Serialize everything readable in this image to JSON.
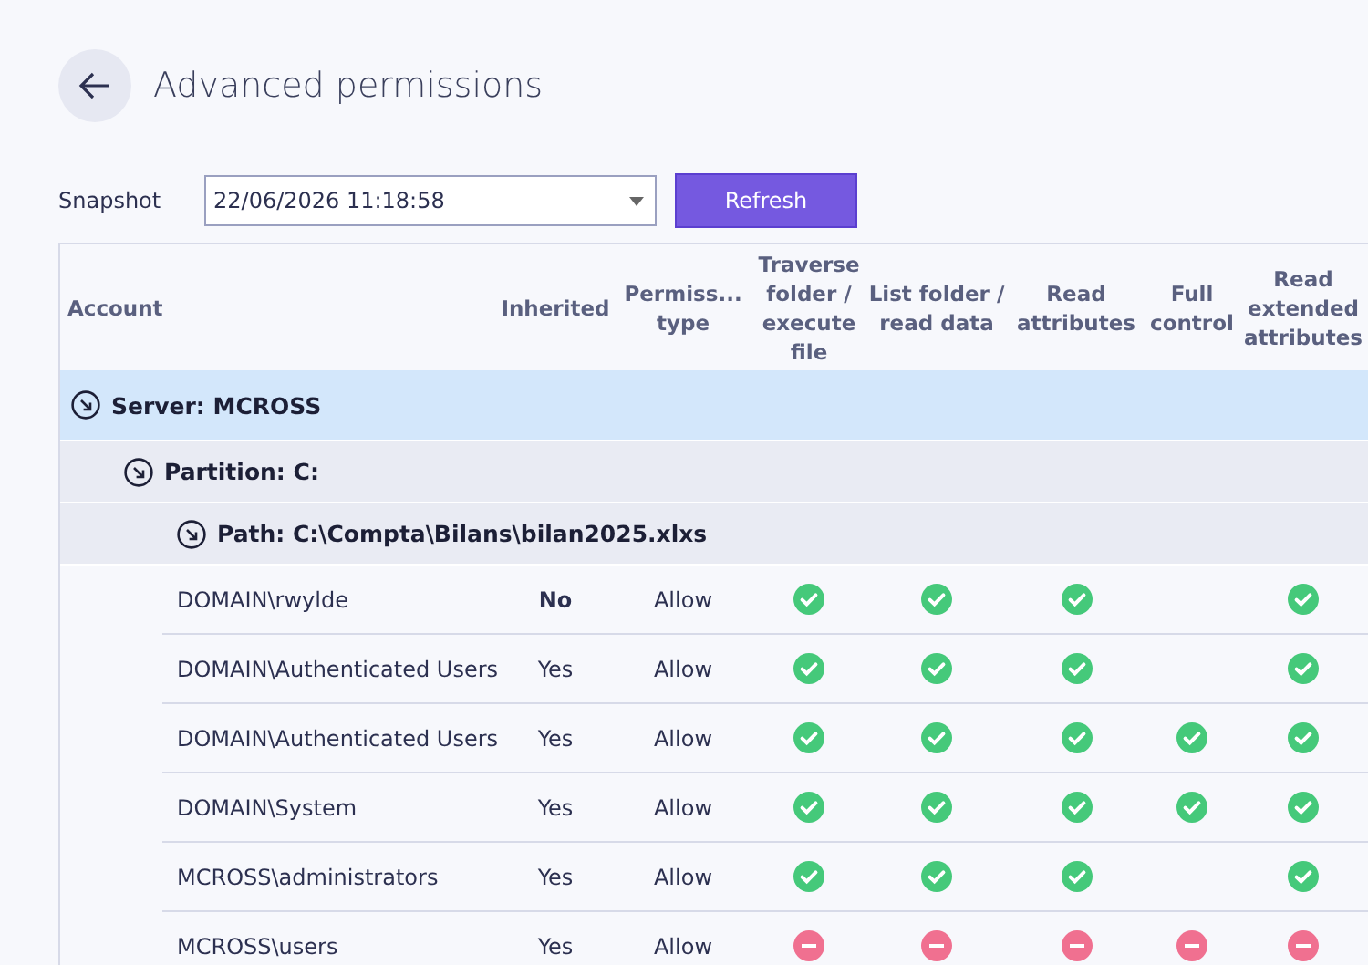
{
  "title": "Advanced permissions",
  "snapshot": {
    "label": "Snapshot",
    "value": "22/06/2026 11:18:58"
  },
  "refresh_button": "Refresh",
  "table": {
    "columns": [
      "Account",
      "Inherited",
      "Permiss... type",
      "Traverse folder / execute file",
      "List folder / read data",
      "Read attributes",
      "Full control",
      "Read extended attributes"
    ],
    "tree": [
      {
        "label": "Server: MCROSS",
        "expanded": true,
        "selected": true,
        "children": [
          {
            "label": "Partition: C:",
            "expanded": true,
            "selected": false,
            "children": [
              {
                "label": "Path: C:\\Compta\\Bilans\\bilan2025.xlxs",
                "expanded": true,
                "selected": false,
                "rows": [
                  {
                    "account": "DOMAIN\\rwylde",
                    "inherited": "No",
                    "explicit": true,
                    "type": "Allow",
                    "perms": [
                      {
                        "kind": "allow"
                      },
                      {
                        "kind": "allow"
                      },
                      {
                        "kind": "allow"
                      },
                      {
                        "kind": "none"
                      },
                      {
                        "kind": "allow"
                      }
                    ]
                  },
                  {
                    "account": "DOMAIN\\Authenticated Users",
                    "inherited": "Yes",
                    "explicit": false,
                    "type": "Allow",
                    "perms": [
                      {
                        "kind": "allow"
                      },
                      {
                        "kind": "allow"
                      },
                      {
                        "kind": "allow"
                      },
                      {
                        "kind": "none"
                      },
                      {
                        "kind": "allow"
                      }
                    ]
                  },
                  {
                    "account": "DOMAIN\\Authenticated Users",
                    "inherited": "Yes",
                    "explicit": false,
                    "type": "Allow",
                    "perms": [
                      {
                        "kind": "allow"
                      },
                      {
                        "kind": "allow"
                      },
                      {
                        "kind": "allow"
                      },
                      {
                        "kind": "allow"
                      },
                      {
                        "kind": "allow"
                      }
                    ]
                  },
                  {
                    "account": "DOMAIN\\System",
                    "inherited": "Yes",
                    "explicit": false,
                    "type": "Allow",
                    "perms": [
                      {
                        "kind": "allow"
                      },
                      {
                        "kind": "allow"
                      },
                      {
                        "kind": "allow"
                      },
                      {
                        "kind": "allow"
                      },
                      {
                        "kind": "allow"
                      }
                    ]
                  },
                  {
                    "account": "MCROSS\\administrators",
                    "inherited": "Yes",
                    "explicit": false,
                    "type": "Allow",
                    "perms": [
                      {
                        "kind": "allow"
                      },
                      {
                        "kind": "allow"
                      },
                      {
                        "kind": "allow"
                      },
                      {
                        "kind": "none"
                      },
                      {
                        "kind": "allow"
                      }
                    ]
                  },
                  {
                    "account": "MCROSS\\users",
                    "inherited": "Yes",
                    "explicit": false,
                    "type": "Allow",
                    "perms": [
                      {
                        "kind": "deny"
                      },
                      {
                        "kind": "deny"
                      },
                      {
                        "kind": "deny"
                      },
                      {
                        "kind": "deny"
                      },
                      {
                        "kind": "deny"
                      }
                    ]
                  }
                ]
              }
            ]
          }
        ]
      }
    ]
  }
}
